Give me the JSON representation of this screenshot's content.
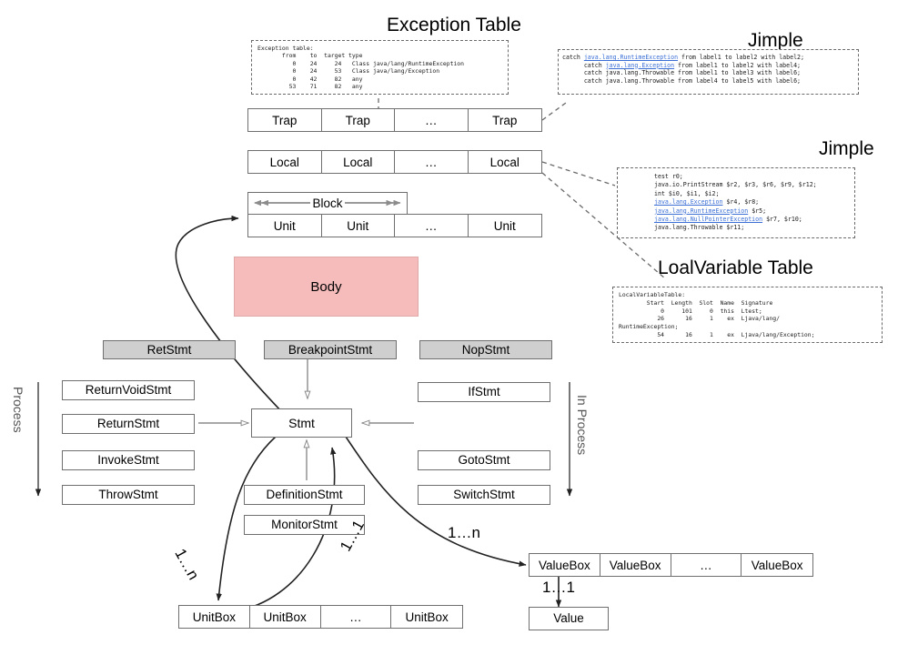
{
  "headings": {
    "exception_table": "Exception Table",
    "jimple_top": "Jimple",
    "jimple_mid": "Jimple",
    "local_variable_table": "LoalVariable Table"
  },
  "exception_table_code": [
    "Exception table:",
    "       from    to  target type",
    "          0    24     24   Class java/lang/RuntimeException",
    "          0    24     53   Class java/lang/Exception",
    "          0    42     82   any",
    "         53    71     82   any"
  ],
  "jimple_top_code": {
    "lines": [
      {
        "pre": "catch ",
        "link": "java.lang.RuntimeException",
        "post": " from label1 to label2 with label2;"
      },
      {
        "pre": "      catch ",
        "link": "java.lang.Exception",
        "post": " from label1 to label2 with label4;"
      },
      {
        "pre": "      catch java.lang.Throwable from label1 to label3 with label6;",
        "link": "",
        "post": ""
      },
      {
        "pre": "      catch java.lang.Throwable from label4 to label5 with label6;",
        "link": "",
        "post": ""
      }
    ]
  },
  "jimple_mid_code": {
    "lines": [
      {
        "pre": "test r0;",
        "link": "",
        "post": ""
      },
      {
        "pre": "java.io.PrintStream $r2, $r3, $r6, $r9, $r12;",
        "link": "",
        "post": ""
      },
      {
        "pre": "int $i0, $i1, $i2;",
        "link": "",
        "post": ""
      },
      {
        "pre": "",
        "link": "java.lang.Exception",
        "post": " $r4, $r8;"
      },
      {
        "pre": "",
        "link": "java.lang.RuntimeException",
        "post": " $r5;"
      },
      {
        "pre": "",
        "link": "java.lang.NullPointerException",
        "post": " $r7, $r10;"
      },
      {
        "pre": "java.lang.Throwable $r11;",
        "link": "",
        "post": ""
      }
    ]
  },
  "local_variable_table_code": [
    "LocalVariableTable:",
    "        Start  Length  Slot  Name  Signature",
    "            0     101     0  this  Ltest;",
    "           26      16     1    ex  Ljava/lang/",
    "RuntimeException;",
    "           54      16     1    ex  Ljava/lang/Exception;"
  ],
  "strips": {
    "trap": {
      "cells": [
        "Trap",
        "Trap",
        "…",
        "Trap"
      ]
    },
    "local": {
      "cells": [
        "Local",
        "Local",
        "…",
        "Local"
      ]
    },
    "unit": {
      "cells": [
        "Unit",
        "Unit",
        "…",
        "Unit"
      ]
    },
    "unitbox": {
      "cells": [
        "UnitBox",
        "UnitBox",
        "…",
        "UnitBox"
      ]
    },
    "valuebox": {
      "cells": [
        "ValueBox",
        "ValueBox",
        "…",
        "ValueBox"
      ]
    }
  },
  "labels": {
    "block": "Block",
    "body": "Body",
    "stmt": "Stmt",
    "value": "Value"
  },
  "stmt_boxes": {
    "gray": [
      {
        "label": "RetStmt"
      },
      {
        "label": "BreakpointStmt"
      },
      {
        "label": "NopStmt"
      }
    ],
    "left": [
      {
        "label": "ReturnVoidStmt"
      },
      {
        "label": "ReturnStmt"
      },
      {
        "label": "InvokeStmt"
      },
      {
        "label": "ThrowStmt"
      }
    ],
    "right": [
      {
        "label": "IfStmt"
      },
      {
        "label": "GotoStmt"
      },
      {
        "label": "SwitchStmt"
      }
    ],
    "bottom": [
      {
        "label": "DefinitionStmt"
      },
      {
        "label": "MonitorStmt"
      }
    ]
  },
  "process_labels": {
    "left": "Process",
    "right": "In Process"
  },
  "multiplicities": {
    "stmt_to_unitbox": "1…n",
    "unitbox_to_stmt": "1…1",
    "stmt_to_valuebox": "1…n",
    "valuebox_to_value": "1…1"
  },
  "colors": {
    "body_fill": "#f6bcbc",
    "gray_fill": "#cfcfcf",
    "border": "#6f6f6f",
    "link": "#3b6fd6",
    "arrow_dark": "#222222",
    "arrow_light": "#8c8c8c"
  }
}
